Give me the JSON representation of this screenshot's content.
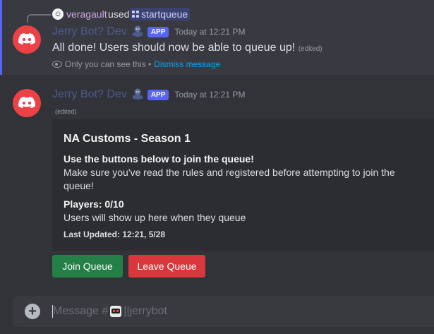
{
  "message1": {
    "reply": {
      "username": "veragault",
      "verb": "used",
      "command": "startqueue"
    },
    "author": "Jerry Bot? Dev",
    "badge": "APP",
    "timestamp": "Today at 12:21 PM",
    "content": "All done! Users should now be able to queue up!",
    "edited": "(edited)",
    "ephemeral_note": "Only you can see this •",
    "dismiss_label": "Dismiss message"
  },
  "message2": {
    "author": "Jerry Bot? Dev",
    "badge": "APP",
    "timestamp": "Today at 12:21 PM",
    "edited": "(edited)",
    "embed": {
      "title": "NA Customs - Season 1",
      "field1_name": "Use the buttons below to join the queue!",
      "field1_value": "Make sure you've read the rules and registered before attempting to join the queue!",
      "field2_name": "Players: 0/10",
      "field2_value": "Users will show up here when they queue",
      "footer": "Last Updated: 12:21, 5/28"
    },
    "buttons": {
      "join": "Join Queue",
      "leave": "Leave Queue"
    }
  },
  "composer": {
    "placeholder_prefix": "Message #",
    "channel": "||jerrybot"
  },
  "colors": {
    "accent": "#5865f2",
    "avatar": "#ed4245",
    "success": "#248046",
    "danger": "#da373c",
    "link": "#00a8fc"
  }
}
